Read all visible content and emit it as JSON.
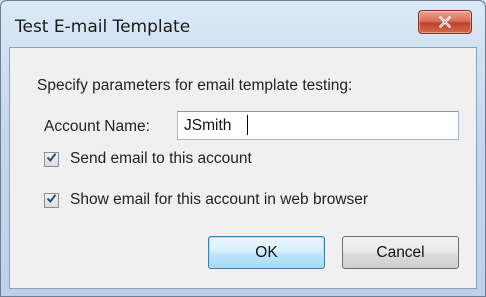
{
  "window": {
    "title": "Test E-mail Template",
    "close_glyph": "X"
  },
  "form": {
    "heading": "Specify parameters for email template testing:",
    "account_label": "Account Name:",
    "account_value": "JSmith",
    "send_email_label": "Send email to this account",
    "send_email_checked": true,
    "show_email_label": "Show email for this account in web browser",
    "show_email_checked": true
  },
  "buttons": {
    "ok": "OK",
    "cancel": "Cancel"
  },
  "colors": {
    "close_button": "#c7513a",
    "ok_focus_border": "#3c7fb1"
  },
  "icons": {
    "close": "close-icon",
    "check": "checkmark-icon"
  }
}
